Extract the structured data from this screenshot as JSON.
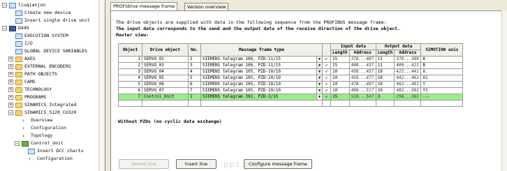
{
  "tree": {
    "items": [
      {
        "label": "liuqianjun",
        "icon": "project-icon",
        "indent": 0,
        "expander": "−"
      },
      {
        "label": "Create new device",
        "icon": "create-device-icon",
        "indent": 1,
        "expander": ""
      },
      {
        "label": "Insert single drive unit",
        "icon": "insert-drive-icon",
        "indent": 1,
        "expander": ""
      },
      {
        "label": "D445",
        "icon": "controller-icon",
        "indent": 0,
        "expander": "−"
      },
      {
        "label": "EXECUTION SYSTEM",
        "icon": "execution-icon",
        "indent": 1,
        "expander": ""
      },
      {
        "label": "I/O",
        "icon": "io-icon",
        "indent": 1,
        "expander": ""
      },
      {
        "label": "GLOBAL DEVICE VARIABLES",
        "icon": "variables-icon",
        "indent": 1,
        "expander": ""
      },
      {
        "label": "AXES",
        "icon": "folder-icon",
        "indent": 1,
        "expander": "+"
      },
      {
        "label": "EXTERNAL ENCODERS",
        "icon": "folder-icon",
        "indent": 1,
        "expander": "+"
      },
      {
        "label": "PATH OBJECTS",
        "icon": "folder-icon",
        "indent": 1,
        "expander": "+"
      },
      {
        "label": "CAMS",
        "icon": "folder-icon",
        "indent": 1,
        "expander": "+"
      },
      {
        "label": "TECHNOLOGY",
        "icon": "folder-icon",
        "indent": 1,
        "expander": "+"
      },
      {
        "label": "PROGRAMS",
        "icon": "folder-icon",
        "indent": 1,
        "expander": "+"
      },
      {
        "label": "SINAMICS_Integrated",
        "icon": "drive-icon",
        "indent": 1,
        "expander": "+"
      },
      {
        "label": "SINAMICS_S120_CU320",
        "icon": "drive-icon",
        "indent": 1,
        "expander": "−"
      },
      {
        "label": "Overview",
        "icon": "arrow-icon",
        "indent": 2,
        "expander": ""
      },
      {
        "label": "Configuration",
        "icon": "arrow-icon",
        "indent": 2,
        "expander": ""
      },
      {
        "label": "Topology",
        "icon": "arrow-icon",
        "indent": 2,
        "expander": ""
      },
      {
        "label": "Control_Unit",
        "icon": "control-unit-icon",
        "indent": 2,
        "expander": "−"
      },
      {
        "label": "Insert DCC charts",
        "icon": "insert-dcc-icon",
        "indent": 3,
        "expander": ""
      },
      {
        "label": "Configuration",
        "icon": "arrow-icon",
        "indent": 3,
        "expander": ""
      }
    ]
  },
  "tabs": [
    {
      "label": "PROFIdrive message frame",
      "active": true
    },
    {
      "label": "Version overview",
      "active": false
    }
  ],
  "info": {
    "line1": "The drive objects are supplied with data in the following sequence from the PROFIBUS message frame:",
    "line2": "The input data corresponds to the send and the output data of the receive direction of the drive object.",
    "line3": "Master view:"
  },
  "table": {
    "headers": {
      "object": "Object",
      "drive_object": "Drive object",
      "no": "No.",
      "frame_type": "Message frame type",
      "input_data": "Input data",
      "output_data": "Output data",
      "length": "Length",
      "address": "Address",
      "simotion_axis": "SIMOTION axis"
    },
    "rows": [
      {
        "object": "1",
        "drive": "SERVO_02",
        "no": "2",
        "frame": "SIEMENS telegram 106, PZD-11/15",
        "check": "✔",
        "in_len": "15",
        "in_addr": "378...407",
        "out_len": "11",
        "out_addr": "378...399",
        "axis": "A",
        "highlight": false
      },
      {
        "object": "2",
        "drive": "SERVO_03",
        "no": "3",
        "frame": "SIEMENS telegram 106, PZD-11/15",
        "check": "✔",
        "in_len": "15",
        "in_addr": "408...437",
        "out_len": "11",
        "out_addr": "400...421",
        "axis": "B",
        "highlight": false
      },
      {
        "object": "3",
        "drive": "SERVO_04",
        "no": "4",
        "frame": "SIEMENS telegram 105, PZD-10/10",
        "check": "✔",
        "in_len": "10",
        "in_addr": "438...457",
        "out_len": "10",
        "out_addr": "422...441",
        "axis": "X",
        "highlight": false
      },
      {
        "object": "4",
        "drive": "SERVO_05",
        "no": "5",
        "frame": "SIEMENS telegram 105, PZD-10/10",
        "check": "✔",
        "in_len": "10",
        "in_addr": "458...477",
        "out_len": "10",
        "out_addr": "442...461",
        "axis": "X1",
        "highlight": false
      },
      {
        "object": "5",
        "drive": "SERVO_06",
        "no": "6",
        "frame": "SIEMENS telegram 105, PZD-10/10",
        "check": "✔",
        "in_len": "10",
        "in_addr": "478...497",
        "out_len": "10",
        "out_addr": "462...481",
        "axis": "Y",
        "highlight": false
      },
      {
        "object": "6",
        "drive": "SERVO_07",
        "no": "7",
        "frame": "SIEMENS telegram 105, PZD-10/10",
        "check": "✔",
        "in_len": "10",
        "in_addr": "498...517",
        "out_len": "10",
        "out_addr": "482...501",
        "axis": "Y1",
        "highlight": false
      },
      {
        "object": "7",
        "drive": "Control_Unit",
        "no": "1",
        "frame": "SIEMENS telegram 392, PZD-3/15",
        "check": "✔",
        "in_len": "15",
        "in_addr": "518...547",
        "out_len": "3",
        "out_addr": "256...261",
        "axis": "---",
        "highlight": true
      }
    ],
    "footer_note": "Without PZDs (no cyclic data exchange)"
  },
  "buttons": {
    "delete_line": "Delete line",
    "insert_line": "Insert line",
    "configure": "Configure message frame"
  },
  "watermark": "ppt.c.cn",
  "colors": {
    "highlight_row": "#9dea8c",
    "check": "#1d3f93"
  }
}
